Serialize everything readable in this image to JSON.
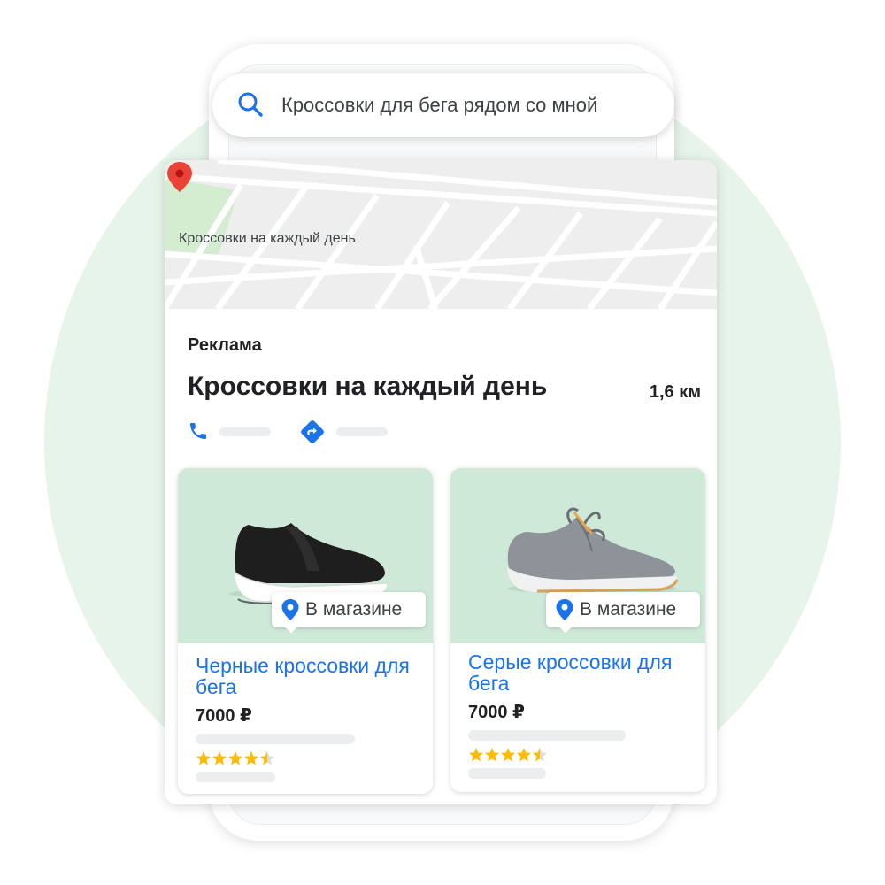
{
  "search": {
    "query": "Кроссовки для бега рядом со мной"
  },
  "map": {
    "label": "Кроссовки на каждый день"
  },
  "listing": {
    "ad_label": "Реклама",
    "store_name": "Кроссовки на каждый день",
    "distance": "1,6 км"
  },
  "products": [
    {
      "badge": "В магазине",
      "title": "Черные кроссовки для бега",
      "price": "7000 ₽",
      "rating": 4.5
    },
    {
      "badge": "В магазине",
      "title": "Серые кроссовки для бега",
      "price": "7000 ₽",
      "rating": 4.5
    }
  ],
  "colors": {
    "accent": "#1a73e8",
    "pin_red": "#ea4335",
    "star": "#fbbc04",
    "circle_bg": "#e6f4ea",
    "product_bg": "#cfe9d8"
  },
  "icons": [
    "search-icon",
    "map-pin-icon",
    "phone-icon",
    "directions-icon",
    "location-pin-icon",
    "star-icon"
  ]
}
